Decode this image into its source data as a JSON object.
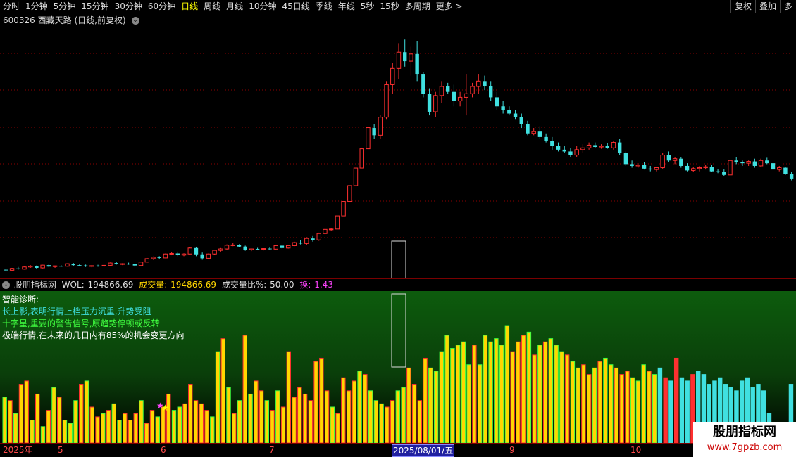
{
  "toolbar": {
    "periods": [
      "分时",
      "1分钟",
      "5分钟",
      "15分钟",
      "30分钟",
      "60分钟",
      "日线",
      "周线",
      "月线",
      "10分钟",
      "45日线",
      "季线",
      "年线",
      "5秒",
      "15秒",
      "多周期",
      "更多 >"
    ],
    "active_period": "日线",
    "right_buttons": [
      "复权",
      "叠加",
      "多"
    ]
  },
  "title": {
    "code": "600326",
    "name": "西藏天路",
    "mode": "(日线,前复权)"
  },
  "indicator": {
    "name": "股朋指标网",
    "wol_label": "WOL:",
    "wol_value": "194866.69",
    "vol_label": "成交量:",
    "vol_value": "194866.69",
    "ratio_label": "成交量比%:",
    "ratio_value": "50.00",
    "swap_label": "换:",
    "swap_value": "1.43"
  },
  "diagnosis": {
    "title": "智能诊断:",
    "line1": "长上影,表明行情上档压力沉重,升势受阻",
    "line2": "十字星,重要的警告信号,原趋势停顿或反转",
    "line3": "极端行情,在未来的几日内有85%的机会变更方向"
  },
  "date_axis": {
    "labels": [
      "2025年",
      "5",
      "6",
      "7",
      "2025/08/01/五",
      "9",
      "10"
    ],
    "highlight": "2025/08/01/五"
  },
  "watermark": {
    "title": "股朋指标网",
    "url": "www.7gpzb.com"
  },
  "colors": {
    "up": "#ff3030",
    "down": "#40e0e0",
    "grid": "#8b0000",
    "vol_yellow": "#ffd700"
  },
  "chart_data": {
    "type": "candlestick",
    "ohlc": [
      [
        5.05,
        5.1,
        4.98,
        5.02
      ],
      [
        5.02,
        5.15,
        5.0,
        5.12
      ],
      [
        5.12,
        5.2,
        5.05,
        5.08
      ],
      [
        5.08,
        5.22,
        5.06,
        5.2
      ],
      [
        5.2,
        5.3,
        5.15,
        5.25
      ],
      [
        5.25,
        5.28,
        5.1,
        5.15
      ],
      [
        5.15,
        5.32,
        5.12,
        5.3
      ],
      [
        5.3,
        5.34,
        5.18,
        5.22
      ],
      [
        5.22,
        5.28,
        5.15,
        5.26
      ],
      [
        5.26,
        5.3,
        5.2,
        5.24
      ],
      [
        5.24,
        5.4,
        5.22,
        5.38
      ],
      [
        5.38,
        5.42,
        5.25,
        5.3
      ],
      [
        5.3,
        5.36,
        5.24,
        5.28
      ],
      [
        5.28,
        5.33,
        5.2,
        5.24
      ],
      [
        5.24,
        5.3,
        5.18,
        5.27
      ],
      [
        5.27,
        5.32,
        5.21,
        5.25
      ],
      [
        5.25,
        5.31,
        5.22,
        5.29
      ],
      [
        5.29,
        5.45,
        5.27,
        5.42
      ],
      [
        5.42,
        5.48,
        5.33,
        5.36
      ],
      [
        5.36,
        5.41,
        5.3,
        5.38
      ],
      [
        5.38,
        5.44,
        5.32,
        5.35
      ],
      [
        5.35,
        5.38,
        5.22,
        5.28
      ],
      [
        5.28,
        5.5,
        5.26,
        5.47
      ],
      [
        5.47,
        5.7,
        5.44,
        5.66
      ],
      [
        5.66,
        5.78,
        5.6,
        5.74
      ],
      [
        5.74,
        5.8,
        5.65,
        5.7
      ],
      [
        5.7,
        5.95,
        5.68,
        5.92
      ],
      [
        5.92,
        6.02,
        5.85,
        5.95
      ],
      [
        5.95,
        6.05,
        5.8,
        5.86
      ],
      [
        5.86,
        5.96,
        5.8,
        5.92
      ],
      [
        5.92,
        6.3,
        5.9,
        6.25
      ],
      [
        6.25,
        6.32,
        5.8,
        5.9
      ],
      [
        5.9,
        6.0,
        5.6,
        5.68
      ],
      [
        5.68,
        5.95,
        5.65,
        5.92
      ],
      [
        5.92,
        6.15,
        5.88,
        6.12
      ],
      [
        6.12,
        6.25,
        6.05,
        6.2
      ],
      [
        6.2,
        6.45,
        6.15,
        6.4
      ],
      [
        6.4,
        6.55,
        6.35,
        6.42
      ],
      [
        6.42,
        6.46,
        6.3,
        6.33
      ],
      [
        6.33,
        6.38,
        6.1,
        6.15
      ],
      [
        6.15,
        6.22,
        6.08,
        6.2
      ],
      [
        6.2,
        6.26,
        6.14,
        6.18
      ],
      [
        6.18,
        6.24,
        6.12,
        6.22
      ],
      [
        6.22,
        6.28,
        6.15,
        6.19
      ],
      [
        6.19,
        6.4,
        6.17,
        6.38
      ],
      [
        6.38,
        6.42,
        6.2,
        6.25
      ],
      [
        6.25,
        6.42,
        6.22,
        6.38
      ],
      [
        6.38,
        6.6,
        6.35,
        6.55
      ],
      [
        6.55,
        6.7,
        6.45,
        6.5
      ],
      [
        6.5,
        6.85,
        6.42,
        6.78
      ],
      [
        6.78,
        6.95,
        6.6,
        6.7
      ],
      [
        6.7,
        7.1,
        6.65,
        7.05
      ],
      [
        7.05,
        7.32,
        7.0,
        7.28
      ],
      [
        7.28,
        7.35,
        7.21,
        7.3
      ],
      [
        7.3,
        8.03,
        8.03,
        8.03
      ],
      [
        8.03,
        8.83,
        8.83,
        8.83
      ],
      [
        8.83,
        9.71,
        9.71,
        9.71
      ],
      [
        9.71,
        10.68,
        10.68,
        10.68
      ],
      [
        10.68,
        11.75,
        11.75,
        11.75
      ],
      [
        11.75,
        12.92,
        12.92,
        12.92
      ],
      [
        12.9,
        13.1,
        12.3,
        12.5
      ],
      [
        12.5,
        13.6,
        12.3,
        13.5
      ],
      [
        13.5,
        15.5,
        13.4,
        15.3
      ],
      [
        15.3,
        16.5,
        14.8,
        16.2
      ],
      [
        16.2,
        17.6,
        15.6,
        17.1
      ],
      [
        17.1,
        17.8,
        16.3,
        16.6
      ],
      [
        16.6,
        17.4,
        15.8,
        17.0
      ],
      [
        17.0,
        17.7,
        15.5,
        15.9
      ],
      [
        15.9,
        16.0,
        14.6,
        14.8
      ],
      [
        14.8,
        15.1,
        13.6,
        13.8
      ],
      [
        13.8,
        14.9,
        13.5,
        14.7
      ],
      [
        14.7,
        15.5,
        14.3,
        15.2
      ],
      [
        15.2,
        15.4,
        14.8,
        14.9
      ],
      [
        14.9,
        15.3,
        14.1,
        14.4
      ],
      [
        14.4,
        14.9,
        14.1,
        14.6
      ],
      [
        14.6,
        15.9,
        13.6,
        14.8
      ],
      [
        14.8,
        15.4,
        14.6,
        15.2
      ],
      [
        15.2,
        15.9,
        14.8,
        15.5
      ],
      [
        15.5,
        15.8,
        15.0,
        15.2
      ],
      [
        15.2,
        15.5,
        14.4,
        14.6
      ],
      [
        14.6,
        14.9,
        13.9,
        14.1
      ],
      [
        14.1,
        14.4,
        13.7,
        13.9
      ],
      [
        13.9,
        14.1,
        13.6,
        13.7
      ],
      [
        13.7,
        13.9,
        13.4,
        13.5
      ],
      [
        13.5,
        13.7,
        12.9,
        13.1
      ],
      [
        13.1,
        13.3,
        12.5,
        12.6
      ],
      [
        12.6,
        12.9,
        12.5,
        12.7
      ],
      [
        12.7,
        13.0,
        12.3,
        12.4
      ],
      [
        12.4,
        12.6,
        12.1,
        12.2
      ],
      [
        12.2,
        12.4,
        11.7,
        11.9
      ],
      [
        11.9,
        12.1,
        11.6,
        11.7
      ],
      [
        11.7,
        11.9,
        11.5,
        11.6
      ],
      [
        11.6,
        11.8,
        11.3,
        11.4
      ],
      [
        11.4,
        11.9,
        11.3,
        11.7
      ],
      [
        11.7,
        12.0,
        11.5,
        11.8
      ],
      [
        11.8,
        12.1,
        11.7,
        11.95
      ],
      [
        11.95,
        12.1,
        11.8,
        11.85
      ],
      [
        11.85,
        12.0,
        11.75,
        11.9
      ],
      [
        11.9,
        12.05,
        11.75,
        11.8
      ],
      [
        11.8,
        12.2,
        11.7,
        12.1
      ],
      [
        12.1,
        12.3,
        11.4,
        11.5
      ],
      [
        11.5,
        11.6,
        10.8,
        10.9
      ],
      [
        10.9,
        11.1,
        10.7,
        10.8
      ],
      [
        10.8,
        10.95,
        10.7,
        10.85
      ],
      [
        10.85,
        11.0,
        10.6,
        10.65
      ],
      [
        10.65,
        10.8,
        10.5,
        10.6
      ],
      [
        10.6,
        10.75,
        10.5,
        10.7
      ],
      [
        10.7,
        11.5,
        10.65,
        11.4
      ],
      [
        11.4,
        11.6,
        11.0,
        11.1
      ],
      [
        11.1,
        11.3,
        10.9,
        11.2
      ],
      [
        11.2,
        11.3,
        10.7,
        10.8
      ],
      [
        10.8,
        10.95,
        10.5,
        10.55
      ],
      [
        10.55,
        10.75,
        10.45,
        10.65
      ],
      [
        10.65,
        10.8,
        10.5,
        10.7
      ],
      [
        10.7,
        10.85,
        10.6,
        10.75
      ],
      [
        10.75,
        10.85,
        10.45,
        10.5
      ],
      [
        10.5,
        10.6,
        10.4,
        10.45
      ],
      [
        10.45,
        10.6,
        10.25,
        10.3
      ],
      [
        10.3,
        11.2,
        10.25,
        11.1
      ],
      [
        11.1,
        11.3,
        10.9,
        11.0
      ],
      [
        11.0,
        11.1,
        10.8,
        10.95
      ],
      [
        10.95,
        11.1,
        10.8,
        11.05
      ],
      [
        11.05,
        11.2,
        10.7,
        10.8
      ],
      [
        10.8,
        11.2,
        10.75,
        11.1
      ],
      [
        11.1,
        11.25,
        10.9,
        10.95
      ],
      [
        10.95,
        11.0,
        10.5,
        10.6
      ],
      [
        10.6,
        10.8,
        10.5,
        10.7
      ],
      [
        10.7,
        10.75,
        10.3,
        10.35
      ],
      [
        10.35,
        10.45,
        10.0,
        10.1
      ]
    ],
    "volume": [
      [
        7.0,
        1
      ],
      [
        6.5,
        1
      ],
      [
        4.5,
        1
      ],
      [
        9.0,
        1
      ],
      [
        9.5,
        1
      ],
      [
        3.5,
        1
      ],
      [
        7.5,
        1
      ],
      [
        2.5,
        1
      ],
      [
        5.0,
        1
      ],
      [
        8.5,
        1
      ],
      [
        7.0,
        1
      ],
      [
        3.5,
        1
      ],
      [
        3.0,
        1
      ],
      [
        6.5,
        1
      ],
      [
        9.0,
        1
      ],
      [
        9.5,
        1
      ],
      [
        5.5,
        1
      ],
      [
        4.0,
        1
      ],
      [
        4.5,
        1
      ],
      [
        5.0,
        1
      ],
      [
        6.0,
        1
      ],
      [
        3.5,
        1
      ],
      [
        4.5,
        1
      ],
      [
        3.5,
        1
      ],
      [
        4.5,
        1
      ],
      [
        6.5,
        1
      ],
      [
        3.0,
        1
      ],
      [
        5.0,
        1
      ],
      [
        4.0,
        1
      ],
      [
        5.5,
        1
      ],
      [
        7.5,
        1
      ],
      [
        5.0,
        1
      ],
      [
        5.5,
        1
      ],
      [
        6.0,
        1
      ],
      [
        9.0,
        1
      ],
      [
        6.5,
        1
      ],
      [
        6.0,
        1
      ],
      [
        5.0,
        1
      ],
      [
        4.0,
        1
      ],
      [
        14.0,
        1
      ],
      [
        16.0,
        1
      ],
      [
        8.5,
        1
      ],
      [
        4.5,
        1
      ],
      [
        6.5,
        1
      ],
      [
        16.5,
        1
      ],
      [
        7.5,
        1
      ],
      [
        9.5,
        1
      ],
      [
        8.0,
        1
      ],
      [
        6.5,
        1
      ],
      [
        5.0,
        1
      ],
      [
        8.0,
        1
      ],
      [
        5.5,
        1
      ],
      [
        14.0,
        1
      ],
      [
        7.0,
        1
      ],
      [
        8.5,
        1
      ],
      [
        7.5,
        1
      ],
      [
        6.5,
        1
      ],
      [
        12.5,
        1
      ],
      [
        13.0,
        1
      ],
      [
        8.0,
        1
      ],
      [
        5.5,
        1
      ],
      [
        4.5,
        1
      ],
      [
        10.0,
        1
      ],
      [
        8.0,
        1
      ],
      [
        9.5,
        1
      ],
      [
        11.0,
        1
      ],
      [
        10.5,
        1
      ],
      [
        8.0,
        1
      ],
      [
        6.5,
        1
      ],
      [
        6.0,
        1
      ],
      [
        5.5,
        1
      ],
      [
        6.5,
        1
      ],
      [
        8.0,
        1
      ],
      [
        8.5,
        1
      ],
      [
        11.5,
        1
      ],
      [
        9.0,
        1
      ],
      [
        6.5,
        1
      ],
      [
        13.0,
        1
      ],
      [
        11.5,
        1
      ],
      [
        11.0,
        1
      ],
      [
        14.0,
        1
      ],
      [
        16.5,
        1
      ],
      [
        14.5,
        1
      ],
      [
        15.0,
        1
      ],
      [
        15.5,
        1
      ],
      [
        12.0,
        1
      ],
      [
        15.0,
        1
      ],
      [
        12.0,
        1
      ],
      [
        16.5,
        1
      ],
      [
        15.5,
        1
      ],
      [
        16.0,
        1
      ],
      [
        15.0,
        1
      ],
      [
        18.0,
        1
      ],
      [
        14.0,
        1
      ],
      [
        15.5,
        1
      ],
      [
        16.5,
        1
      ],
      [
        17.0,
        1
      ],
      [
        13.5,
        1
      ],
      [
        15.0,
        1
      ],
      [
        15.5,
        1
      ],
      [
        16.0,
        1
      ],
      [
        15.0,
        1
      ],
      [
        14.0,
        1
      ],
      [
        13.5,
        1
      ],
      [
        12.5,
        1
      ],
      [
        11.5,
        1
      ],
      [
        12.0,
        1
      ],
      [
        10.5,
        1
      ],
      [
        11.5,
        1
      ],
      [
        12.5,
        1
      ],
      [
        13.0,
        1
      ],
      [
        12.0,
        1
      ],
      [
        11.5,
        1
      ],
      [
        10.5,
        1
      ],
      [
        11.0,
        1
      ],
      [
        10.0,
        1
      ],
      [
        9.5,
        1
      ],
      [
        12.0,
        1
      ],
      [
        11.0,
        1
      ],
      [
        10.5,
        1
      ],
      [
        11.5,
        1
      ],
      [
        10.0,
        1
      ],
      [
        9.5,
        1
      ],
      [
        13.0,
        1
      ],
      [
        10.0,
        1
      ],
      [
        9.5,
        1
      ],
      [
        10.5,
        1
      ],
      [
        11.0,
        1
      ],
      [
        10.5,
        1
      ],
      [
        9.0,
        1
      ],
      [
        9.5,
        1
      ],
      [
        10.0,
        1
      ],
      [
        9.0,
        1
      ],
      [
        8.5,
        1
      ],
      [
        8.0,
        1
      ],
      [
        9.5,
        1
      ],
      [
        10.0,
        1
      ],
      [
        8.5,
        1
      ],
      [
        9.0,
        1
      ],
      [
        8.0,
        1
      ],
      [
        4.5,
        1
      ],
      [
        3.0,
        1
      ],
      [
        2.5,
        1
      ],
      [
        2.0,
        1
      ],
      [
        9.0,
        1
      ]
    ],
    "ylim": [
      4.8,
      18.2
    ]
  }
}
